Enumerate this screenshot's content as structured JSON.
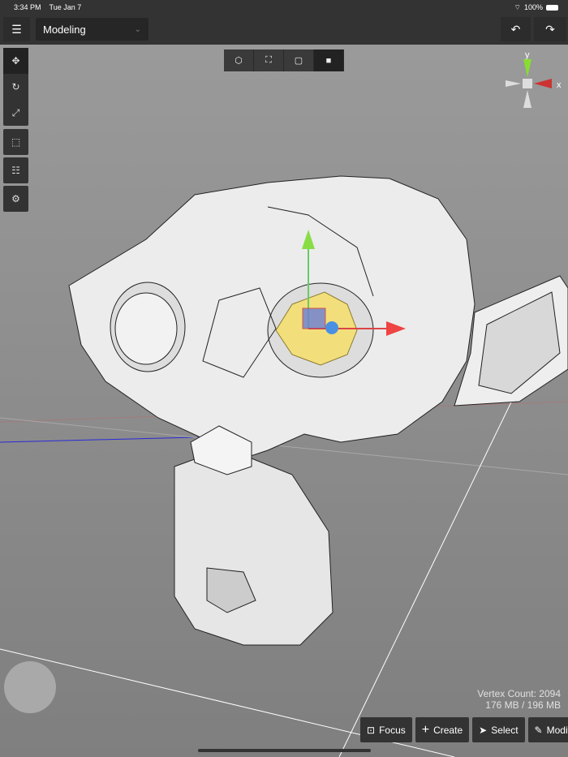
{
  "status": {
    "time": "3:34 PM",
    "date": "Tue Jan 7",
    "battery": "100%"
  },
  "header": {
    "mode": "Modeling",
    "menu_icon": "hamburger-icon",
    "undo_icon": "undo-icon",
    "redo_icon": "redo-icon"
  },
  "tools": [
    "move",
    "rotate",
    "scale",
    "box-select",
    "hierarchy",
    "settings"
  ],
  "select_modes": [
    "object",
    "vertex",
    "edge",
    "face"
  ],
  "active_select_mode": "face",
  "gizmo": {
    "y_label": "y",
    "x_label": "x"
  },
  "info": {
    "vertex_count": "Vertex Count: 2094",
    "memory": "176 MB / 196 MB"
  },
  "actions": {
    "focus": "Focus",
    "create": "Create",
    "select": "Select",
    "modify": "Modify"
  }
}
